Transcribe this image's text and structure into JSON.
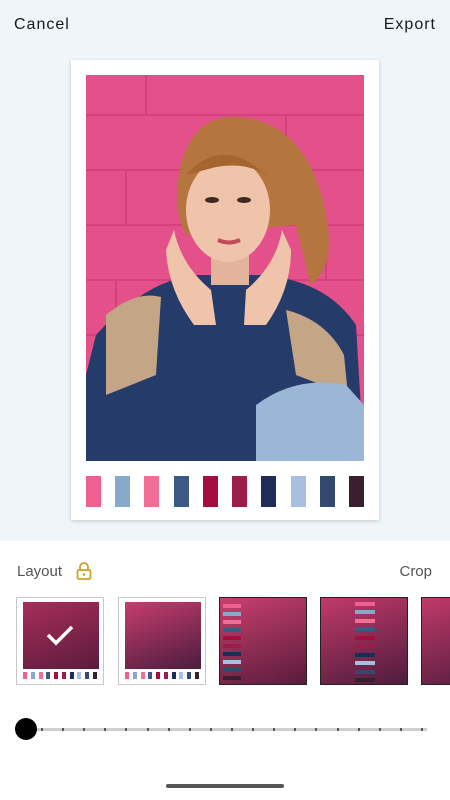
{
  "header": {
    "cancel_label": "Cancel",
    "export_label": "Export"
  },
  "palette": [
    "#ef6091",
    "#88a9cc",
    "#ef6f97",
    "#3d5a86",
    "#a50d3e",
    "#9a1e49",
    "#1f2c5a",
    "#a8bfe0",
    "#33496e",
    "#3a1f2e"
  ],
  "layout_bar": {
    "layout_label": "Layout",
    "lock_icon": "lock-icon",
    "crop_label": "Crop"
  },
  "thumbnails": [
    {
      "style": "photo-with-palette-row",
      "selected": true
    },
    {
      "style": "photo-with-palette-row",
      "selected": false
    },
    {
      "style": "photo-with-palette-column-left",
      "selected": false
    },
    {
      "style": "photo-with-palette-column-center",
      "selected": false
    },
    {
      "style": "photo-partial",
      "selected": false
    }
  ],
  "slider": {
    "value": 0
  },
  "colors": {
    "accent_gold": "#c9a227",
    "background_top": "#f0f5fa"
  }
}
